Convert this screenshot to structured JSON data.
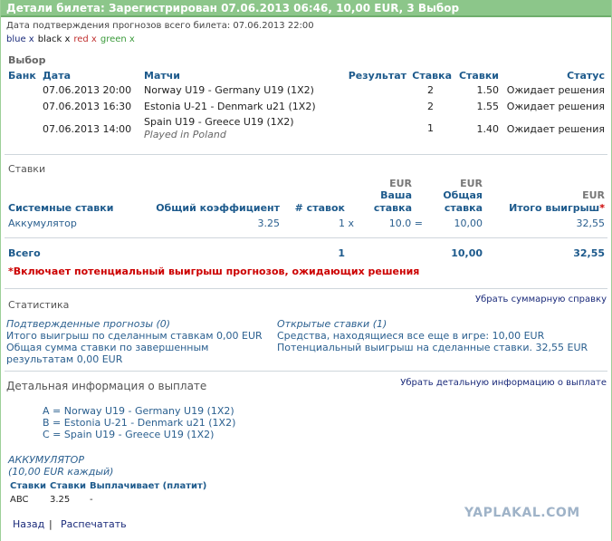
{
  "header": {
    "title": "Детали билета: Зарегистрирован 07.06.2013 06:46, 10,00 EUR, 3 Выбор"
  },
  "confirm_date": "Дата подтверждения прогнозов всего билета: 07.06.2013 22:00",
  "colors": [
    {
      "label": "blue x",
      "color": "#1a2a7a"
    },
    {
      "label": "black x",
      "color": "#111111"
    },
    {
      "label": "red x",
      "color": "#c03030"
    },
    {
      "label": "green x",
      "color": "#3a9a3a"
    }
  ],
  "selection": {
    "title": "Выбор",
    "headers": {
      "bank": "Банк",
      "date": "Дата",
      "match": "Матчи",
      "result": "Результат",
      "stake": "Ставка",
      "odds": "Ставки",
      "status": "Статус"
    },
    "rows": [
      {
        "date": "07.06.2013 20:00",
        "match": "Norway U19 - Germany U19 (1X2)",
        "note": "",
        "result": "2",
        "odds": "1.50",
        "status": "Ожидает решения"
      },
      {
        "date": "07.06.2013 16:30",
        "match": "Estonia U-21 - Denmark u21 (1X2)",
        "note": "",
        "result": "2",
        "odds": "1.55",
        "status": "Ожидает решения"
      },
      {
        "date": "07.06.2013 14:00",
        "match": "Spain U19 - Greece U19 (1X2)",
        "note": "Played in Poland",
        "result": "1",
        "odds": "1.40",
        "status": "Ожидает решения"
      }
    ]
  },
  "bets": {
    "title": "Ставки",
    "currency": "EUR",
    "headers": {
      "system": "Системные ставки",
      "total_odds": "Общий коэффициент",
      "num": "# ставок",
      "your1": "Ваша",
      "your2": "ставка",
      "total1": "Общая",
      "total2": "ставка",
      "win": "Итого выигрыш",
      "star": "*"
    },
    "row": {
      "type": "Аккумулятор",
      "odds": "3.25",
      "num": "1 x",
      "stake": "10.0 =",
      "total": "10,00",
      "win": "32,55"
    },
    "sum": {
      "label": "Всего",
      "num": "1",
      "total": "10,00",
      "win": "32,55"
    },
    "note": "*Включает потенциальный выигрыш прогнозов, ожидающих решения"
  },
  "stats": {
    "title": "Статистика",
    "hide_link": "Убрать суммарную справку",
    "confirmed": "Подтвержденные прогнозы (0)",
    "total_win": "Итого выигрыш по сделанным ставкам 0,00 EUR",
    "total_stake1": "Общая сумма ставки по завершенным",
    "total_stake2": "результатам 0,00 EUR",
    "open": "Открытые ставки (1)",
    "in_play": "Средства, находящиеся все еще в игре: 10,00 EUR",
    "potential": "Потенциальный выигрыш на сделанные ставки. 32,55 EUR"
  },
  "payout": {
    "title": "Детальная информация о выплате",
    "hide_link": "Убрать детальную информацию о выплате",
    "legend": [
      "A = Norway U19 - Germany U19 (1X2)",
      "B = Estonia U-21 - Denmark u21 (1X2)",
      "C = Spain U19 - Greece U19 (1X2)"
    ],
    "type": "АККУМУЛЯТОР",
    "each": "(10,00 EUR каждый)",
    "headers": [
      "Ставки",
      "Ставки",
      "Выплачивает (платит)"
    ],
    "row": [
      "ABC",
      "3.25",
      "-"
    ]
  },
  "footer": {
    "back": "Назад",
    "sep": "|",
    "print": "Распечатать",
    "watermark": "YAPLAKAL.COM"
  }
}
